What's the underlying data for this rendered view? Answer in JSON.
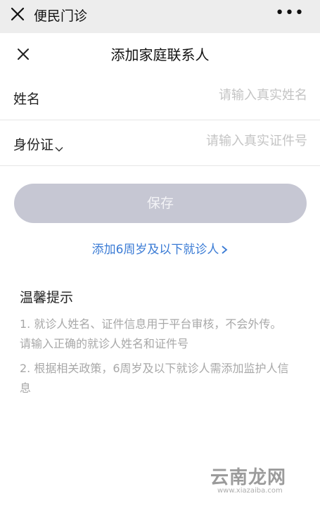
{
  "topbar": {
    "title": "便民门诊",
    "more_label": "•••"
  },
  "dialog": {
    "title": "添加家庭联系人"
  },
  "form": {
    "name_label": "姓名",
    "name_placeholder": "请输入真实姓名",
    "id_label": "身份证",
    "id_placeholder": "请输入真实证件号"
  },
  "actions": {
    "save_label": "保存",
    "add_child_label": "添加6周岁及以下就诊人"
  },
  "tips": {
    "title": "温馨提示",
    "items": [
      "1. 就诊人姓名、证件信息用于平台审核，不会外传。请输入正确的就诊人姓名和证件号",
      "2. 根据相关政策，6周岁及以下就诊人需添加监护人信息"
    ]
  },
  "watermark": {
    "text": "云南龙网",
    "sub": "www.xiazaiba.com"
  },
  "colors": {
    "topbar_bg": "#ededed",
    "save_button_bg": "#c6c7d3",
    "link": "#3a7bd5",
    "tip_text": "#a8a8a8",
    "placeholder": "#c4c4c4"
  }
}
